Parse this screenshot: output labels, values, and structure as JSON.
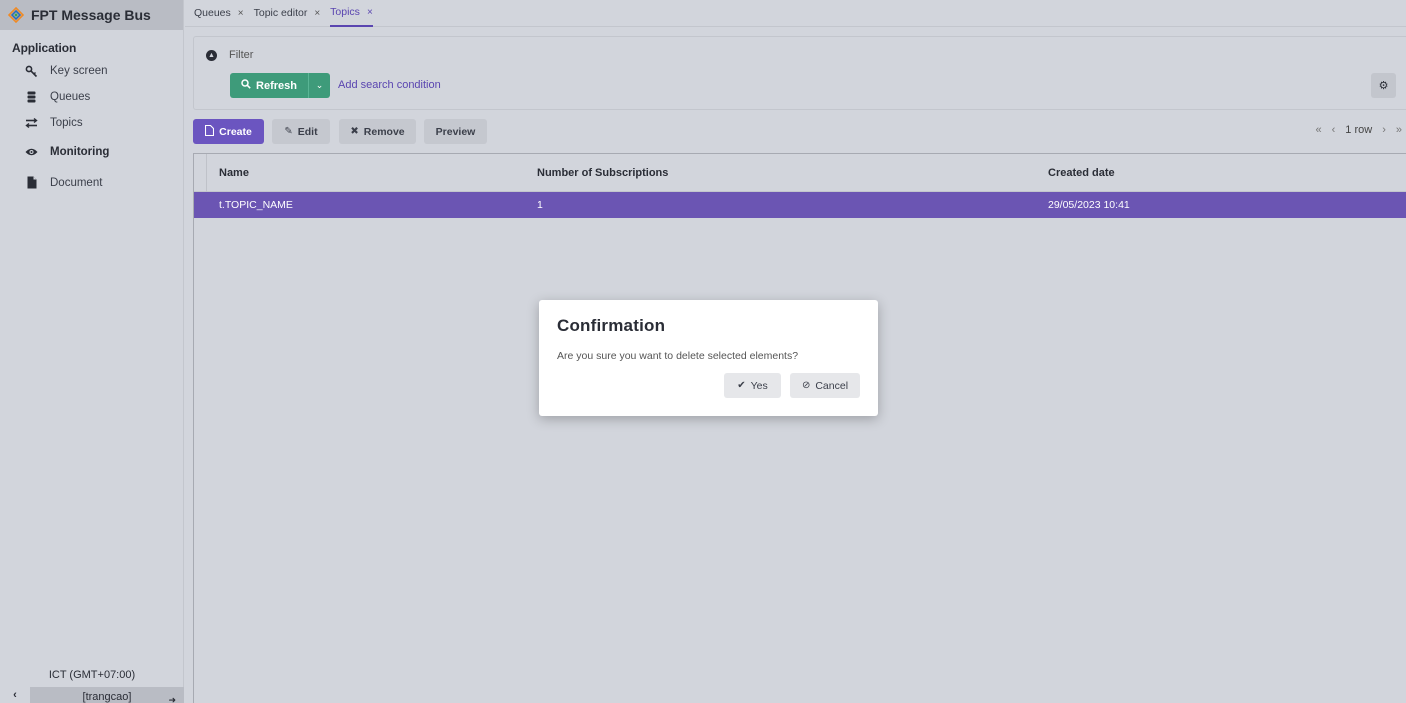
{
  "app": {
    "title": "FPT Message Bus",
    "logo_icon": "fpt-logo-icon"
  },
  "sidebar": {
    "section_title": "Application",
    "items": [
      {
        "label": "Key screen",
        "icon": "key-icon"
      },
      {
        "label": "Queues",
        "icon": "database-icon"
      },
      {
        "label": "Topics",
        "icon": "arrows-exchange-icon"
      },
      {
        "label": "Monitoring",
        "icon": "eye-icon"
      },
      {
        "label": "Document",
        "icon": "file-icon"
      }
    ],
    "timezone": "ICT (GMT+07:00)",
    "user": "[trangcao]"
  },
  "tabs": [
    {
      "label": "Queues",
      "close": "×",
      "active": false
    },
    {
      "label": "Topic editor",
      "close": "×",
      "active": false
    },
    {
      "label": "Topics",
      "close": "×",
      "active": true
    }
  ],
  "filter": {
    "label": "Filter",
    "refresh_label": "Refresh",
    "add_condition_label": "Add search condition"
  },
  "toolbar": {
    "create_label": "Create",
    "edit_label": "Edit",
    "remove_label": "Remove",
    "preview_label": "Preview"
  },
  "pager": {
    "first": "«",
    "prev": "‹",
    "rows": "1 row",
    "next": "›",
    "last": "»"
  },
  "grid": {
    "columns": [
      "Name",
      "Number of Subscriptions",
      "Created date"
    ],
    "rows": [
      {
        "name": "t.TOPIC_NAME",
        "subscriptions": "1",
        "created": "29/05/2023 10:41",
        "selected": true
      }
    ]
  },
  "dialog": {
    "title": "Confirmation",
    "message": "Are you sure you want to delete selected elements?",
    "yes_label": "Yes",
    "cancel_label": "Cancel"
  },
  "colors": {
    "primary": "#6b55c0",
    "refresh_green": "#3e9b7a",
    "selected_row": "#6b55b3",
    "background": "#d2d5dc"
  }
}
